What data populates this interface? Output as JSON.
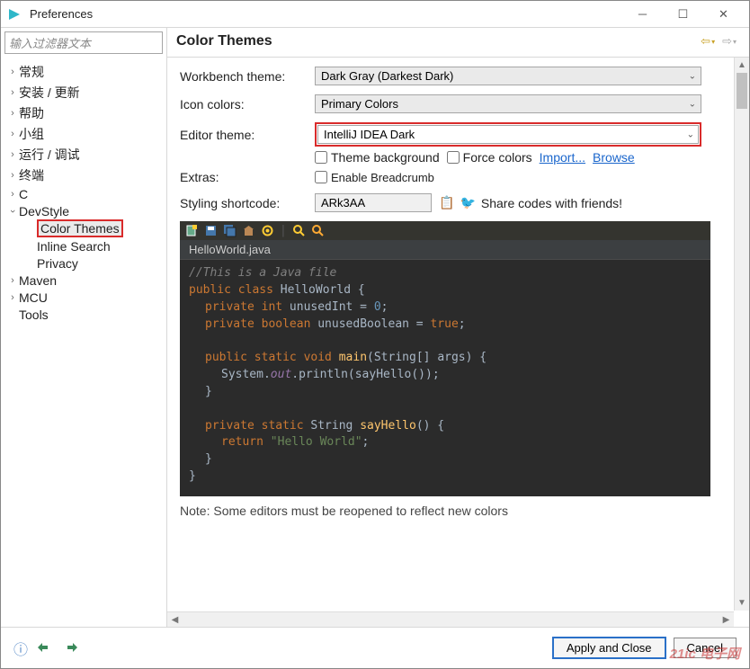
{
  "window": {
    "title": "Preferences"
  },
  "filter_placeholder": "输入过滤器文本",
  "tree": {
    "items": [
      {
        "label": "常规",
        "expandable": true
      },
      {
        "label": "安装 / 更新",
        "expandable": true
      },
      {
        "label": "帮助",
        "expandable": true
      },
      {
        "label": "小组",
        "expandable": true
      },
      {
        "label": "运行 / 调试",
        "expandable": true
      },
      {
        "label": "终端",
        "expandable": true
      },
      {
        "label": "C",
        "expandable": true
      }
    ],
    "devstyle": {
      "label": "DevStyle",
      "children": {
        "color_themes": "Color Themes",
        "inline_search": "Inline Search",
        "privacy": "Privacy"
      }
    },
    "rest": [
      {
        "label": "Maven",
        "expandable": true
      },
      {
        "label": "MCU",
        "expandable": true
      },
      {
        "label": "Tools",
        "expandable": false
      }
    ]
  },
  "page_title": "Color Themes",
  "form": {
    "workbench_label": "Workbench theme:",
    "workbench_value": "Dark Gray (Darkest Dark)",
    "icon_label": "Icon colors:",
    "icon_value": "Primary Colors",
    "editor_label": "Editor theme:",
    "editor_value": "IntelliJ IDEA Dark",
    "theme_background": "Theme background",
    "force_colors": "Force colors",
    "import": "Import...",
    "browse": "Browse",
    "extras_label": "Extras:",
    "enable_breadcrumb": "Enable Breadcrumb",
    "shortcode_label": "Styling shortcode:",
    "shortcode_value": "ARk3AA",
    "share_text": "Share codes with friends!"
  },
  "editor": {
    "tab": "HelloWorld.java",
    "code": {
      "l1": "//This is a Java file",
      "l2a": "public class",
      "l2b": " HelloWorld {",
      "l3a": "private int",
      "l3b": " unusedInt = ",
      "l3c": "0",
      "l3d": ";",
      "l4a": "private boolean",
      "l4b": " unusedBoolean = ",
      "l4c": "true",
      "l4d": ";",
      "l5a": "public static void",
      "l5b": " main",
      "l5c": "(String[] ",
      "l5d": "args",
      "l5e": ") {",
      "l6a": "System.",
      "l6b": "out",
      "l6c": ".println(sayHello());",
      "l7": "}",
      "l8a": "private static ",
      "l8b": "String ",
      "l8c": "sayHello",
      "l8d": "() {",
      "l9a": "return ",
      "l9b": "\"Hello World\"",
      "l9c": ";",
      "l10": "}",
      "l11": "}"
    }
  },
  "note": "Note: Some editors must be reopened to reflect new colors",
  "footer": {
    "apply_close": "Apply and Close",
    "cancel": "Cancel"
  },
  "watermark": "21ic 电子网"
}
